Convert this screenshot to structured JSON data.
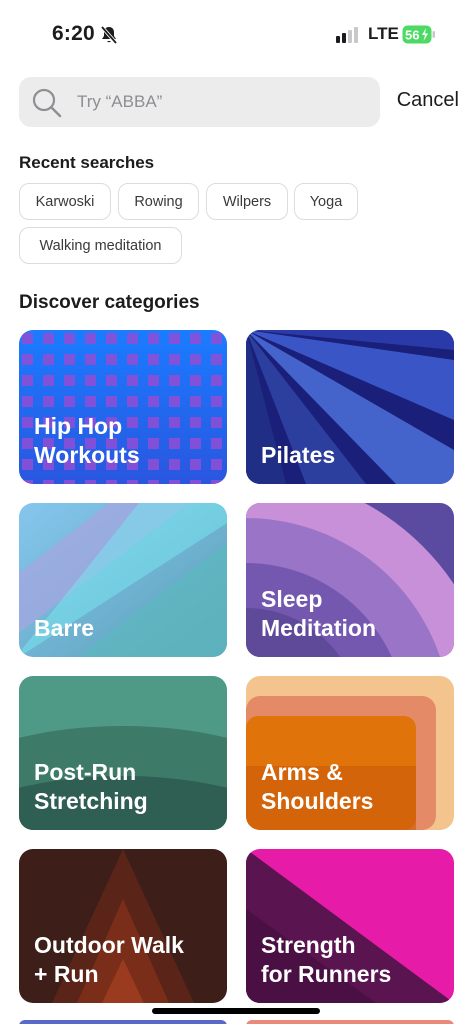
{
  "status": {
    "time": "6:20",
    "network": "LTE",
    "battery": "56"
  },
  "search": {
    "placeholder": "Try “ABBA”",
    "cancel_label": "Cancel"
  },
  "recent": {
    "title": "Recent searches",
    "items": [
      "Karwoski",
      "Rowing",
      "Wilpers",
      "Yoga",
      "Walking meditation"
    ]
  },
  "discover": {
    "title": "Discover categories",
    "categories": [
      {
        "label": "Hip Hop\nWorkouts"
      },
      {
        "label": "Pilates"
      },
      {
        "label": "Barre"
      },
      {
        "label": "Sleep\nMeditation"
      },
      {
        "label": "Post-Run\nStretching"
      },
      {
        "label": "Arms &\nShoulders"
      },
      {
        "label": "Outdoor Walk\n+ Run"
      },
      {
        "label": "Strength\nfor Runners"
      }
    ]
  },
  "colors": {
    "battery_green": "#4cd964",
    "chip_border": "#dcdcdc",
    "search_bg": "#ececec"
  },
  "icons": {
    "status": [
      "bell-slash-icon",
      "signal-icon",
      "battery-icon"
    ],
    "search": "search-icon"
  }
}
